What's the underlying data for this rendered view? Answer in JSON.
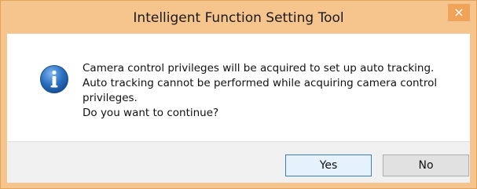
{
  "window": {
    "title": "Intelligent Function Setting Tool",
    "close_glyph": "×"
  },
  "dialog": {
    "icon": "info-icon",
    "message_lines": [
      "Camera control privileges will be acquired to set up auto tracking.",
      "Auto tracking cannot be performed while acquiring camera control",
      "privileges.",
      "Do you want to continue?"
    ]
  },
  "buttons": {
    "yes_label": "Yes",
    "no_label": "No"
  },
  "colors": {
    "frame": "#f6c58d",
    "close_button": "#f0a45a",
    "info_icon": "#2a6fc0"
  }
}
